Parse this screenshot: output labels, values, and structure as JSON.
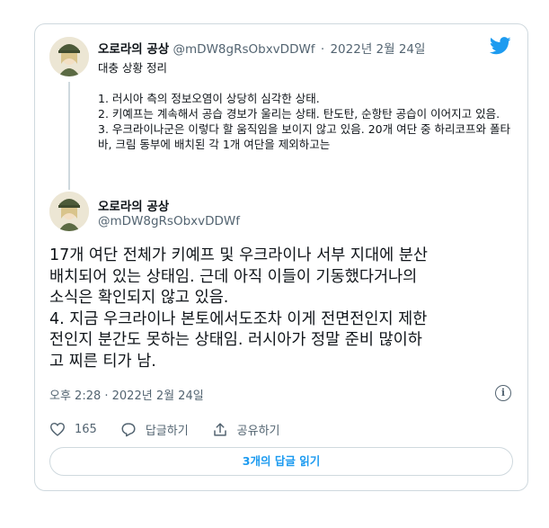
{
  "parent_tweet": {
    "display_name": "오로라의 공상",
    "handle": "@mDW8gRsObxvDDWf",
    "separator": "·",
    "date": "2022년 2월 24일",
    "summary": "대충 상황 정리",
    "items": [
      "1. 러시아 측의 정보오염이 상당히 심각한 상태.",
      "2. 키예프는 계속해서 공습 경보가 울리는 상태. 탄도탄, 순항탄 공습이 이어지고 있음.",
      "3. 우크라이나군은 이렇다 할 움직임을 보이지 않고 있음. 20개 여단 중 하리코프와 폴타바, 크림 동부에 배치된 각 1개 여단을 제외하고는"
    ]
  },
  "main_tweet": {
    "display_name": "오로라의 공상",
    "handle": "@mDW8gRsObxvDDWf",
    "text_lines": [
      "17개 여단 전체가 키예프 및 우크라이나 서부 지대에 분산",
      "배치되어 있는 상태임. 근데 아직 이들이 기동했다거나의",
      "소식은 확인되지 않고 있음.",
      "4. 지금 우크라이나 본토에서도조차 이게 전면전인지 제한",
      "전인지 분간도 못하는 상태임. 러시아가 정말 준비 많이하",
      "고 찌른 티가 남."
    ],
    "timestamp": "오후 2:28 · 2022년 2월 24일"
  },
  "actions": {
    "like_count": "165",
    "reply_label": "답글하기",
    "share_label": "공유하기"
  },
  "replies_button_label": "3개의 답글 읽기",
  "colors": {
    "accent": "#1d9bf0",
    "secondary_text": "#536471",
    "border": "#cfd9de"
  },
  "icons": [
    "twitter-logo-icon",
    "info-icon",
    "heart-icon",
    "reply-bubble-icon",
    "share-icon"
  ]
}
